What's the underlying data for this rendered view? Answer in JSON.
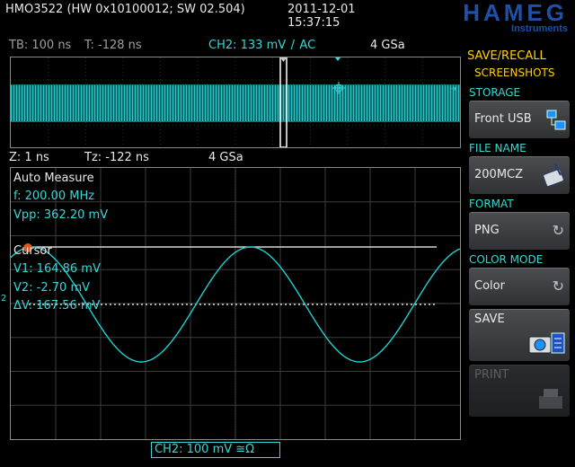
{
  "header": {
    "device": "HMO3522 (HW 0x10100012; SW 02.504)",
    "date": "2011-12-01",
    "time": "15:37:15",
    "brand": "HAMEG",
    "brand_sub": "Instruments",
    "brand_color": "#1f4fa8"
  },
  "timebase": {
    "tb": "TB: 100 ns",
    "t": "T: -128 ns",
    "channel": "CH2: 133 mV",
    "coupling": "AC",
    "sample": "4 GSa"
  },
  "zoom": {
    "z": "Z: 1 ns",
    "tz": "Tz: -122 ns",
    "sample": "4 GSa"
  },
  "auto_measure": {
    "title": "Auto Measure",
    "freq": "f: 200.00 MHz",
    "vpp": "Vpp: 362.20 mV"
  },
  "cursor": {
    "title": "Cursor",
    "v1": "V1: 164.86 mV",
    "v2": "V2: -2.70 mV",
    "dv": "ΔV: 167.56 mV"
  },
  "channel_marker": "2",
  "status_box": "CH2: 100 mV ≅Ω",
  "sidebar": {
    "title": "SAVE/RECALL",
    "subtitle": "SCREENSHOTS",
    "storage_label": "STORAGE",
    "storage_value": "Front USB",
    "filename_label": "FILE NAME",
    "filename_value": "200MCZ",
    "format_label": "FORMAT",
    "format_value": "PNG",
    "colormode_label": "COLOR MODE",
    "colormode_value": "Color",
    "save_label": "SAVE",
    "print_label": "PRINT"
  },
  "colors": {
    "trace": "#1fd0d0",
    "sidebar_title": "#ffd200",
    "accent": "#3ad6d6"
  },
  "icons": {
    "storage": "usb-folder-icon",
    "filename": "keyboard-edit-icon",
    "cycle": "cycle-arrow-icon",
    "save": "camera-save-icon",
    "print": "printer-icon"
  }
}
